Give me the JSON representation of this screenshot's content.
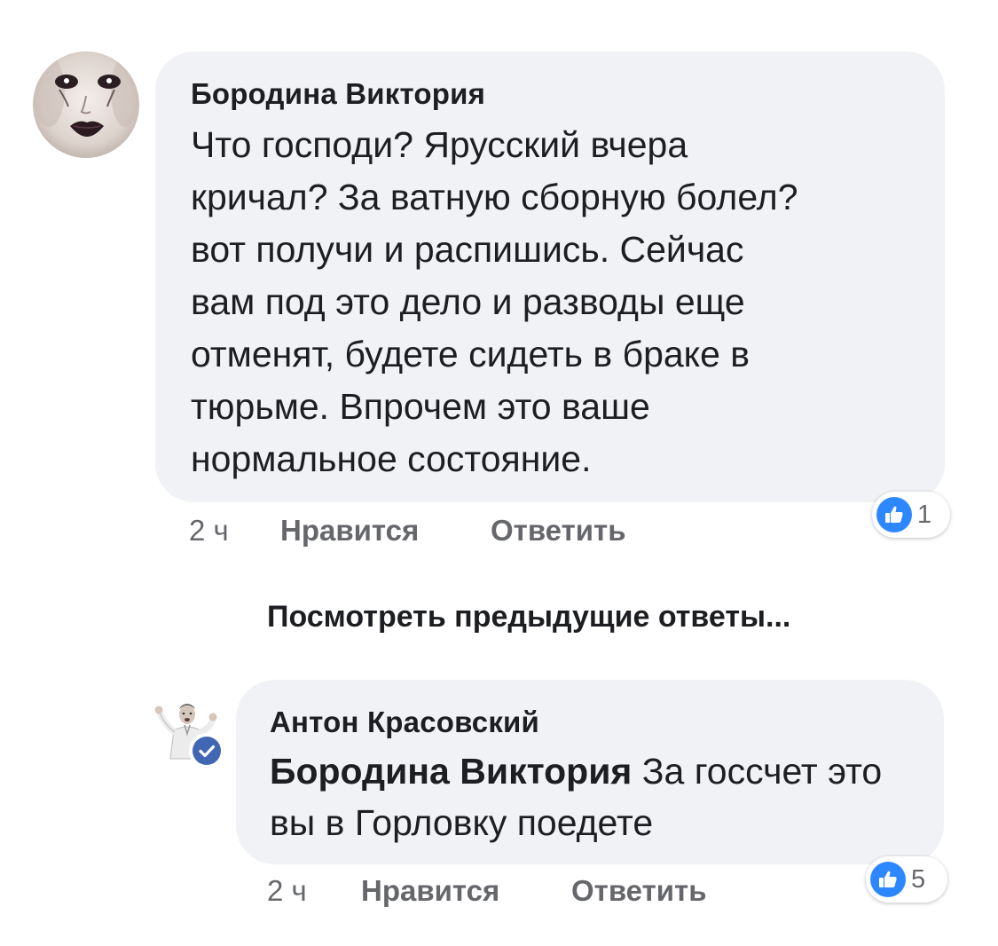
{
  "comments": [
    {
      "author": "Бородина Виктория",
      "text": "Что господи? Ярусский вчера\nкричал? За ватную сборную болел?\nвот получи и распишись. Сейчас\nвам под это дело и разводы еще\nотменят, будете сидеть в браке в\nтюрьме. Впрочем это ваше\nнормальное состояние.",
      "time": "2 ч",
      "like_label": "Нравится",
      "reply_label": "Ответить",
      "reaction_count": "1",
      "reaction_icon": "thumbs-up-icon"
    }
  ],
  "view_previous_label": "Посмотреть предыдущие ответы...",
  "replies": [
    {
      "author": "Антон Красовский",
      "verified": true,
      "mention": "Бородина Виктория",
      "text": "За госсчет это вы в Горловку поедете",
      "time": "2 ч",
      "like_label": "Нравится",
      "reply_label": "Ответить",
      "reaction_count": "5",
      "reaction_icon": "thumbs-up-icon"
    }
  ],
  "colors": {
    "bubble": "#f0f2f5",
    "text": "#1c1e21",
    "secondary": "#65676b",
    "like_blue": "#2d88ff",
    "verified_blue": "#4267b2"
  }
}
